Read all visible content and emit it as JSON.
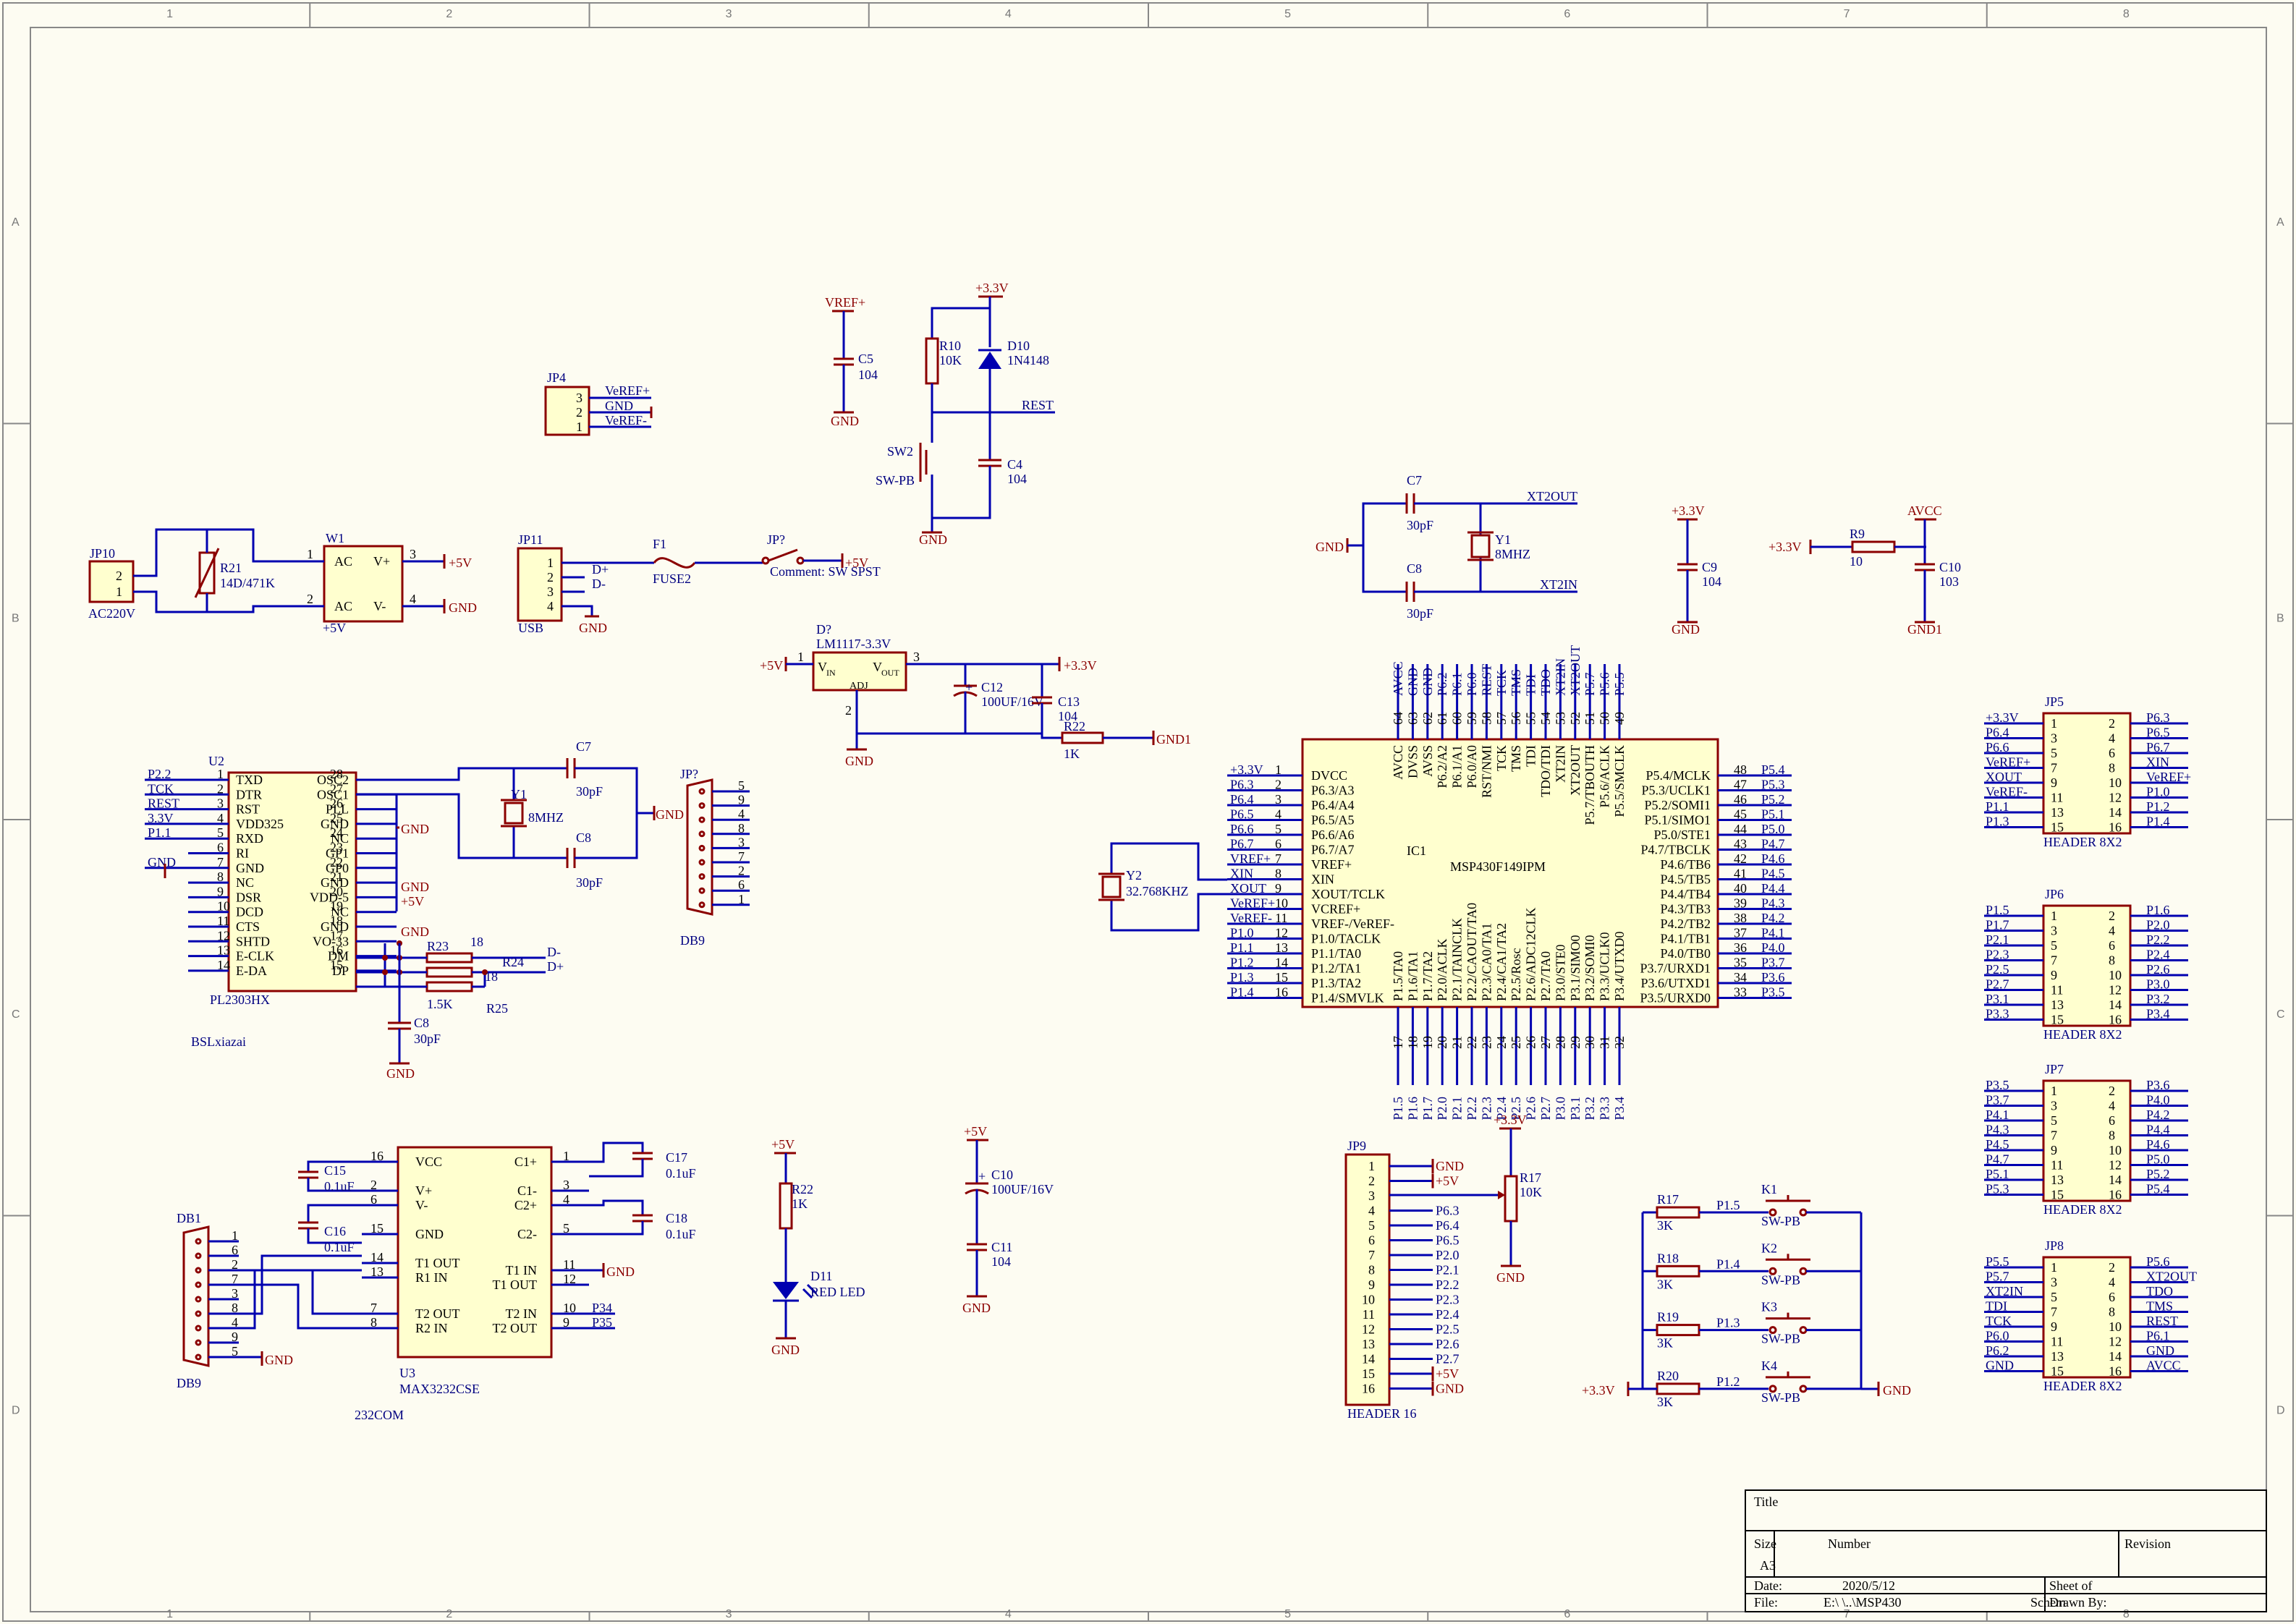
{
  "frame": {
    "cols": [
      "1",
      "2",
      "3",
      "4",
      "5",
      "6",
      "7",
      "8"
    ],
    "rows": [
      "A",
      "B",
      "C",
      "D"
    ]
  },
  "title_block": {
    "title_label": "Title",
    "size_label": "Size",
    "size_value": "A3",
    "number_label": "Number",
    "revision_label": "Revision",
    "date_label": "Date:",
    "date_value": "2020/5/12",
    "sheet_label": "Sheet    of",
    "file_label": "File:",
    "file_value": "E:\\                  \\..\\MSP430",
    "file_tail": "Schem",
    "drawn_by_label": "Drawn By:"
  },
  "power_supply": {
    "jp10": {
      "ref": "JP10",
      "value": "AC220V",
      "pins": [
        "2",
        "1"
      ]
    },
    "r21": {
      "ref": "R21",
      "value": "14D/471K"
    },
    "w1": {
      "ref": "W1",
      "value": "+5V",
      "pins": {
        "ac1": "AC",
        "ac2": "AC",
        "vp": "V+",
        "vm": "V-",
        "p1": "1",
        "p2": "2",
        "p3": "3",
        "p4": "4"
      }
    },
    "out_plus": "+5V",
    "out_gnd": "GND",
    "jp11": {
      "ref": "JP11",
      "value": "USB",
      "pins": [
        "1",
        "2",
        "3",
        "4"
      ],
      "nets": [
        "D+",
        "D-"
      ],
      "gnd": "GND"
    },
    "f1": {
      "ref": "F1",
      "value": "FUSE2"
    },
    "sw": {
      "ref": "JP?",
      "comment": "Comment: SW SPST",
      "net": "+5V"
    },
    "jp4": {
      "ref": "JP4",
      "pins": [
        "3",
        "2",
        "1"
      ],
      "nets": [
        "VeREF+",
        "GND",
        "VeREF-"
      ]
    }
  },
  "reference": {
    "vref_net": "VREF+",
    "c5": {
      "ref": "C5",
      "value": "104"
    },
    "gnd": "GND"
  },
  "reset": {
    "vcc": "+3.3V",
    "r10": {
      "ref": "R10",
      "value": "10K"
    },
    "d10": {
      "ref": "D10",
      "value": "1N4148"
    },
    "net": "REST",
    "sw2": {
      "ref": "SW2",
      "value": "SW-PB"
    },
    "c4": {
      "ref": "C4",
      "value": "104"
    },
    "gnd": "GND"
  },
  "regulator": {
    "ref": "D?",
    "value": "LM1117-3.3V",
    "vin": "V",
    "vin_sub": "IN",
    "vout": "V",
    "vout_sub": "OUT",
    "adj": "ADJ",
    "in_net": "+5V",
    "out_net": "+3.3V",
    "pins": [
      "1",
      "3",
      "2"
    ],
    "c12": {
      "ref": "C12",
      "value": "100UF/16V",
      "plus": "+"
    },
    "c13": {
      "ref": "C13",
      "value": "104"
    },
    "r22": {
      "ref": "R22",
      "value": "1K"
    },
    "gnd": "GND",
    "gnd1": "GND1"
  },
  "crystal_main": {
    "c7": {
      "ref": "C7",
      "value": "30pF"
    },
    "c8": {
      "ref": "C8",
      "value": "30pF"
    },
    "y1": {
      "ref": "Y1",
      "value": "8MHZ"
    },
    "xt2out": "XT2OUT",
    "xt2in": "XT2IN",
    "gnd": "GND"
  },
  "decoupling": {
    "c9": {
      "net": "+3.3V",
      "ref": "C9",
      "value": "104",
      "gnd": "GND"
    },
    "c10": {
      "net": "AVCC",
      "ref": "C10",
      "value": "103",
      "gnd": "GND1",
      "r9": "R9",
      "r9_value": "10",
      "in_net": "+3.3V"
    }
  },
  "mcu": {
    "ref": "IC1",
    "part": "MSP430F149IPM",
    "y2": {
      "ref": "Y2",
      "value": "32.768KHZ"
    },
    "left_pins": [
      {
        "num": "1",
        "name": "DVCC",
        "net": "+3.3V"
      },
      {
        "num": "2",
        "name": "P6.3/A3",
        "net": "P6.3"
      },
      {
        "num": "3",
        "name": "P6.4/A4",
        "net": "P6.4"
      },
      {
        "num": "4",
        "name": "P6.5/A5",
        "net": "P6.5"
      },
      {
        "num": "5",
        "name": "P6.6/A6",
        "net": "P6.6"
      },
      {
        "num": "6",
        "name": "P6.7/A7",
        "net": "P6.7"
      },
      {
        "num": "7",
        "name": "VREF+",
        "net": "VREF+"
      },
      {
        "num": "8",
        "name": "XIN",
        "net": "XIN"
      },
      {
        "num": "9",
        "name": "XOUT/TCLK",
        "net": "XOUT"
      },
      {
        "num": "10",
        "name": "VCREF+",
        "net": "VeREF+"
      },
      {
        "num": "11",
        "name": "VREF-/VeREF-",
        "net": "VeREF-"
      },
      {
        "num": "12",
        "name": "P1.0/TACLK",
        "net": "P1.0"
      },
      {
        "num": "13",
        "name": "P1.1/TA0",
        "net": "P1.1"
      },
      {
        "num": "14",
        "name": "P1.2/TA1",
        "net": "P1.2"
      },
      {
        "num": "15",
        "name": "P1.3/TA2",
        "net": "P1.3"
      },
      {
        "num": "16",
        "name": "P1.4/SMVLK",
        "net": "P1.4"
      }
    ],
    "right_pins": [
      {
        "num": "48",
        "name": "P5.4/MCLK",
        "net": "P5.4"
      },
      {
        "num": "47",
        "name": "P5.3/UCLK1",
        "net": "P5.3"
      },
      {
        "num": "46",
        "name": "P5.2/SOMI1",
        "net": "P5.2"
      },
      {
        "num": "45",
        "name": "P5.1/SIMO1",
        "net": "P5.1"
      },
      {
        "num": "44",
        "name": "P5.0/STE1",
        "net": "P5.0"
      },
      {
        "num": "43",
        "name": "P4.7/TBCLK",
        "net": "P4.7"
      },
      {
        "num": "42",
        "name": "P4.6/TB6",
        "net": "P4.6"
      },
      {
        "num": "41",
        "name": "P4.5/TB5",
        "net": "P4.5"
      },
      {
        "num": "40",
        "name": "P4.4/TB4",
        "net": "P4.4"
      },
      {
        "num": "39",
        "name": "P4.3/TB3",
        "net": "P4.3"
      },
      {
        "num": "38",
        "name": "P4.2/TB2",
        "net": "P4.2"
      },
      {
        "num": "37",
        "name": "P4.1/TB1",
        "net": "P4.1"
      },
      {
        "num": "36",
        "name": "P4.0/TB0",
        "net": "P4.0"
      },
      {
        "num": "35",
        "name": "P3.7/URXD1",
        "net": "P3.7"
      },
      {
        "num": "34",
        "name": "P3.6/UTXD1",
        "net": "P3.6"
      },
      {
        "num": "33",
        "name": "P3.5/URXD0",
        "net": "P3.5"
      }
    ],
    "top_pins": [
      {
        "num": "64",
        "name": "AVCC",
        "net": "AVCC"
      },
      {
        "num": "63",
        "name": "DVSS",
        "net": "GND"
      },
      {
        "num": "62",
        "name": "AVSS",
        "net": "GND"
      },
      {
        "num": "61",
        "name": "P6.2/A2",
        "net": "P6.2"
      },
      {
        "num": "60",
        "name": "P6.1/A1",
        "net": "P6.1"
      },
      {
        "num": "59",
        "name": "P6.0/A0",
        "net": "P6.0"
      },
      {
        "num": "58",
        "name": "RST/NMI",
        "net": "REST"
      },
      {
        "num": "57",
        "name": "TCK",
        "net": "TCK"
      },
      {
        "num": "56",
        "name": "TMS",
        "net": "TMS"
      },
      {
        "num": "55",
        "name": "TDI",
        "net": "TDI"
      },
      {
        "num": "54",
        "name": "TDO/TDI",
        "net": "TDO"
      },
      {
        "num": "53",
        "name": "XT2IN",
        "net": "XT2IN"
      },
      {
        "num": "52",
        "name": "XT2OUT",
        "net": "XT2OUT"
      },
      {
        "num": "51",
        "name": "P5.7/TBOUTH",
        "net": "P5.7"
      },
      {
        "num": "50",
        "name": "P5.6/ACLK",
        "net": "P5.6"
      },
      {
        "num": "49",
        "name": "P5.5/SMCLK",
        "net": "P5.5"
      }
    ],
    "bottom_pins": [
      {
        "num": "17",
        "name": "P1.5/TA0",
        "net": "P1.5"
      },
      {
        "num": "18",
        "name": "P1.6/TA1",
        "net": "P1.6"
      },
      {
        "num": "19",
        "name": "P1.7/TA2",
        "net": "P1.7"
      },
      {
        "num": "20",
        "name": "P2.0/ACLK",
        "net": "P2.0"
      },
      {
        "num": "21",
        "name": "P2.1/TAINCLK",
        "net": "P2.1"
      },
      {
        "num": "22",
        "name": "P2.2/CAOUT/TA0",
        "net": "P2.2"
      },
      {
        "num": "23",
        "name": "P2.3/CA0/TA1",
        "net": "P2.3"
      },
      {
        "num": "24",
        "name": "P2.4/CA1/TA2",
        "net": "P2.4"
      },
      {
        "num": "25",
        "name": "P2.5/Rosc",
        "net": "P2.5"
      },
      {
        "num": "26",
        "name": "P2.6/ADC12CLK",
        "net": "P2.6"
      },
      {
        "num": "27",
        "name": "P2.7/TA0",
        "net": "P2.7"
      },
      {
        "num": "28",
        "name": "P3.0/STE0",
        "net": "P3.0"
      },
      {
        "num": "29",
        "name": "P3.1/SIMO0",
        "net": "P3.1"
      },
      {
        "num": "30",
        "name": "P3.2/SOMI0",
        "net": "P3.2"
      },
      {
        "num": "31",
        "name": "P3.3/UCLK0",
        "net": "P3.3"
      },
      {
        "num": "32",
        "name": "P3.4/UTXD0",
        "net": "P3.4"
      }
    ]
  },
  "usb_bridge": {
    "ref": "U2",
    "part": "PL2303HX",
    "caption": "BSLxiazai",
    "left_pins": [
      {
        "num": "1",
        "name": "TXD",
        "net": "P2.2"
      },
      {
        "num": "2",
        "name": "DTR",
        "net": "TCK"
      },
      {
        "num": "3",
        "name": "RST",
        "net": "REST"
      },
      {
        "num": "4",
        "name": "VDD325",
        "net": "3.3V"
      },
      {
        "num": "5",
        "name": "RXD",
        "net": "P1.1"
      },
      {
        "num": "6",
        "name": "RI",
        "net": ""
      },
      {
        "num": "7",
        "name": "GND",
        "net": "GND"
      },
      {
        "num": "8",
        "name": "NC",
        "net": ""
      },
      {
        "num": "9",
        "name": "DSR",
        "net": ""
      },
      {
        "num": "10",
        "name": "DCD",
        "net": ""
      },
      {
        "num": "11",
        "name": "CTS",
        "net": ""
      },
      {
        "num": "12",
        "name": "SHTD",
        "net": ""
      },
      {
        "num": "13",
        "name": "E-CLK",
        "net": ""
      },
      {
        "num": "14",
        "name": "E-DA",
        "net": ""
      }
    ],
    "right_pins": [
      {
        "num": "28",
        "name": "OSC2"
      },
      {
        "num": "27",
        "name": "OSC1"
      },
      {
        "num": "26",
        "name": "PLL"
      },
      {
        "num": "25",
        "name": "GND"
      },
      {
        "num": "24",
        "name": "NC"
      },
      {
        "num": "23",
        "name": "GP1"
      },
      {
        "num": "22",
        "name": "GP0"
      },
      {
        "num": "21",
        "name": "GND"
      },
      {
        "num": "20",
        "name": "VDD-5"
      },
      {
        "num": "19",
        "name": "NC"
      },
      {
        "num": "18",
        "name": "GND"
      },
      {
        "num": "17",
        "name": "VO-33"
      },
      {
        "num": "16",
        "name": "DM"
      },
      {
        "num": "15",
        "name": "DP"
      }
    ],
    "nets_right": {
      "gnd": "GND",
      "p5v": "+5V"
    },
    "c7": {
      "ref": "C7",
      "value": "30pF"
    },
    "c8a": {
      "ref": "C8",
      "value": "30pF"
    },
    "y1": {
      "ref": "Y1",
      "value": "8MHZ"
    },
    "gnd": "GND",
    "r23": {
      "ref": "R23",
      "value": "1.5K"
    },
    "r24": {
      "ref": "R24",
      "value": "18"
    },
    "r25": {
      "ref": "R25",
      "value": "18"
    },
    "r18": "18",
    "dm": "D-",
    "dp": "D+",
    "c8b": {
      "ref": "C8",
      "value": "30pF"
    },
    "db9": {
      "ref": "JP?",
      "label": "DB9",
      "pins": [
        "5",
        "9",
        "4",
        "8",
        "3",
        "7",
        "2",
        "6",
        "1"
      ]
    }
  },
  "rs232": {
    "ref": "U3",
    "part": "MAX3232CSE",
    "caption": "232COM",
    "pins_left": [
      {
        "num": "16",
        "name": "VCC"
      },
      {
        "num": "2",
        "name": "V+"
      },
      {
        "num": "6",
        "name": "V-"
      },
      {
        "num": "15",
        "name": "GND"
      },
      {
        "num": "14",
        "name": "T1 OUT"
      },
      {
        "num": "13",
        "name": "R1 IN"
      },
      {
        "num": "7",
        "name": "T2 OUT"
      },
      {
        "num": "8",
        "name": "R2 IN"
      }
    ],
    "pins_right": [
      {
        "num": "1",
        "name": "C1+"
      },
      {
        "num": "3",
        "name": "C1-"
      },
      {
        "num": "4",
        "name": "C2+"
      },
      {
        "num": "5",
        "name": "C2-"
      },
      {
        "num": "11",
        "name": "T1 IN"
      },
      {
        "num": "12",
        "name": "T1 OUT"
      },
      {
        "num": "10",
        "name": "T2 IN",
        "net": "P34"
      },
      {
        "num": "9",
        "name": "T2 OUT",
        "net": "P35"
      }
    ],
    "t1in_net": "GND",
    "c15": {
      "ref": "C15",
      "value": "0.1uF"
    },
    "c16": {
      "ref": "C16",
      "value": "0.1uF"
    },
    "c17": {
      "ref": "C17",
      "value": "0.1uF"
    },
    "c18": {
      "ref": "C18",
      "value": "0.1uF"
    },
    "db1": {
      "ref": "DB1",
      "label": "DB9",
      "pins": [
        "1",
        "6",
        "2",
        "7",
        "3",
        "8",
        "4",
        "9",
        "5"
      ],
      "gnd": "GND"
    }
  },
  "led": {
    "net": "+5V",
    "r22": {
      "ref": "R22",
      "value": "1K"
    },
    "d11": {
      "ref": "D11",
      "value": "RED LED"
    },
    "gnd": "GND"
  },
  "bulk_cap": {
    "net": "+5V",
    "c10": {
      "ref": "C10",
      "value": "100UF/16V",
      "plus": "+"
    },
    "c11": {
      "ref": "C11",
      "value": "104"
    },
    "gnd": "GND"
  },
  "jp9": {
    "ref": "JP9",
    "label": "HEADER 16",
    "pins": [
      "1",
      "2",
      "3",
      "4",
      "5",
      "6",
      "7",
      "8",
      "9",
      "10",
      "11",
      "12",
      "13",
      "14",
      "15",
      "16"
    ],
    "nets": [
      "GND",
      "+5V",
      "",
      "P6.3",
      "P6.4",
      "P6.5",
      "P2.0",
      "P2.1",
      "P2.2",
      "P2.3",
      "P2.4",
      "P2.5",
      "P2.6",
      "P2.7",
      "+5V",
      "GND"
    ],
    "r17": {
      "ref": "R17",
      "value": "10K",
      "net": "+3.3V",
      "gnd": "GND"
    }
  },
  "keys": {
    "vcc": "+3.3V",
    "gnd": "GND",
    "rows": [
      {
        "r": "R17",
        "rv": "3K",
        "net": "P1.5",
        "k": "K1",
        "kv": "SW-PB"
      },
      {
        "r": "R18",
        "rv": "3K",
        "net": "P1.4",
        "k": "K2",
        "kv": "SW-PB"
      },
      {
        "r": "R19",
        "rv": "3K",
        "net": "P1.3",
        "k": "K3",
        "kv": "SW-PB"
      },
      {
        "r": "R20",
        "rv": "3K",
        "net": "P1.2",
        "k": "K4",
        "kv": "SW-PB"
      }
    ]
  },
  "headers": [
    {
      "ref": "JP5",
      "label": "HEADER 8X2",
      "left": [
        "+3.3V",
        "P6.4",
        "P6.6",
        "VeREF+",
        "XOUT",
        "VeREF-",
        "P1.1",
        "P1.3"
      ],
      "right": [
        "P6.3",
        "P6.5",
        "P6.7",
        "XIN",
        "VeREF+",
        "P1.0",
        "P1.2",
        "P1.4"
      ]
    },
    {
      "ref": "JP6",
      "label": "HEADER 8X2",
      "left": [
        "P1.5",
        "P1.7",
        "P2.1",
        "P2.3",
        "P2.5",
        "P2.7",
        "P3.1",
        "P3.3"
      ],
      "right": [
        "P1.6",
        "P2.0",
        "P2.2",
        "P2.4",
        "P2.6",
        "P3.0",
        "P3.2",
        "P3.4"
      ]
    },
    {
      "ref": "JP7",
      "label": "HEADER 8X2",
      "left": [
        "P3.5",
        "P3.7",
        "P4.1",
        "P4.3",
        "P4.5",
        "P4.7",
        "P5.1",
        "P5.3"
      ],
      "right": [
        "P3.6",
        "P4.0",
        "P4.2",
        "P4.4",
        "P4.6",
        "P5.0",
        "P5.2",
        "P5.4"
      ]
    },
    {
      "ref": "JP8",
      "label": "HEADER 8X2",
      "left": [
        "P5.5",
        "P5.7",
        "XT2IN",
        "TDI",
        "TCK",
        "P6.0",
        "P6.2",
        "GND"
      ],
      "right": [
        "P5.6",
        "XT2OUT",
        "TDO",
        "TMS",
        "REST",
        "P6.1",
        "GND",
        "AVCC"
      ]
    }
  ],
  "header_pin_numbers": {
    "odd": [
      "1",
      "3",
      "5",
      "7",
      "9",
      "11",
      "13",
      "15"
    ],
    "even": [
      "2",
      "4",
      "6",
      "8",
      "10",
      "12",
      "14",
      "16"
    ]
  }
}
